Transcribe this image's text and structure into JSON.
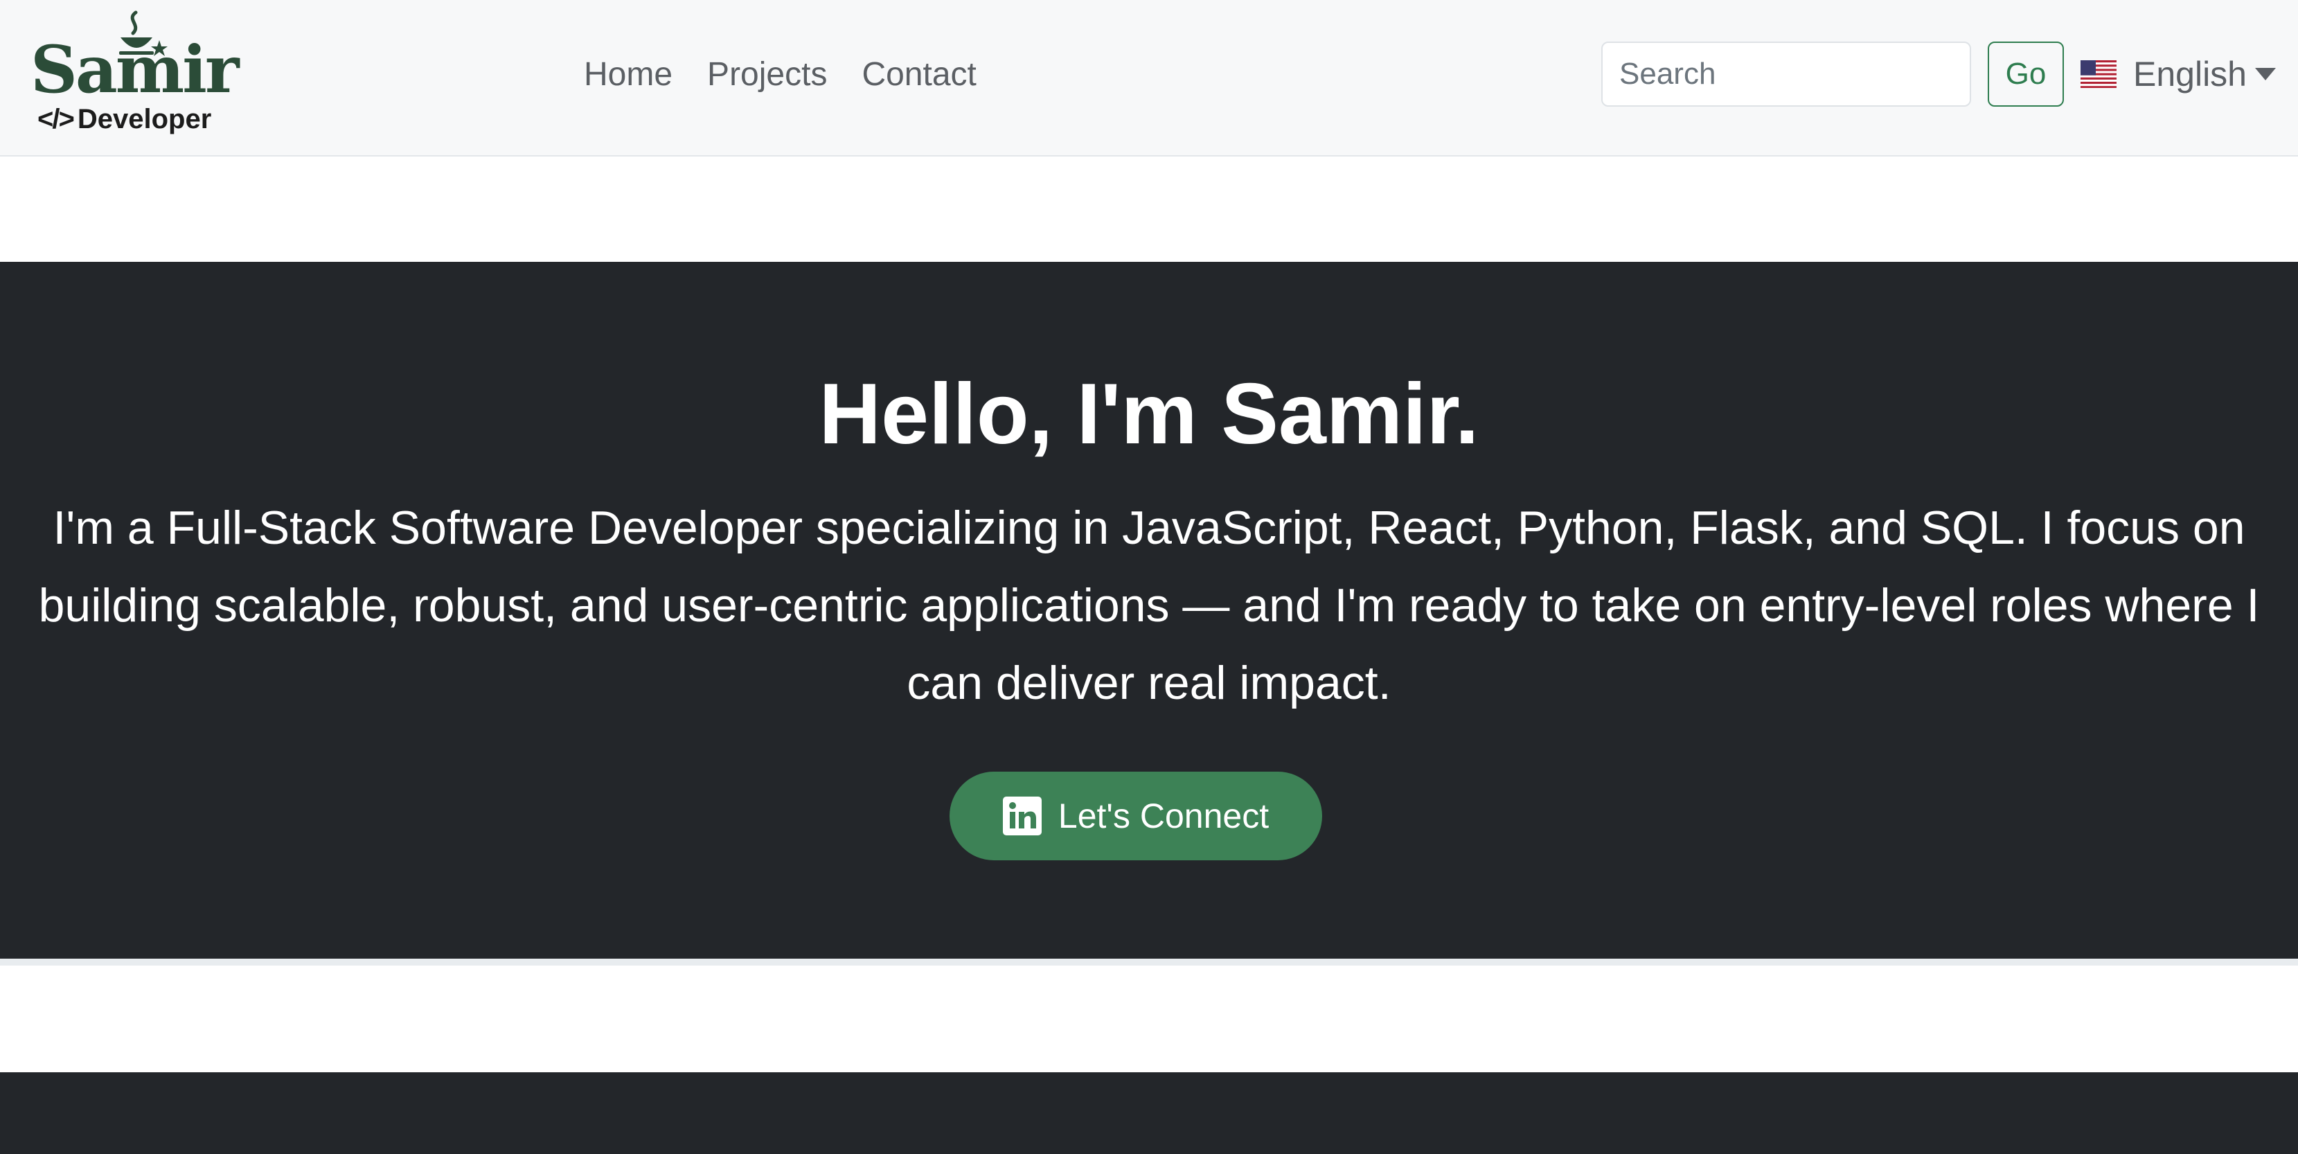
{
  "brand": {
    "name": "Samir",
    "code_glyph": "</>",
    "tagline": "Developer",
    "color": "#2b4c38"
  },
  "nav": {
    "links": [
      "Home",
      "Projects",
      "Contact"
    ]
  },
  "search": {
    "placeholder": "Search",
    "value": "",
    "button_label": "Go"
  },
  "language": {
    "label": "English",
    "flag_icon": "us-flag-icon"
  },
  "hero": {
    "title": "Hello, I'm Samir.",
    "description": "I'm a Full-Stack Software Developer specializing in JavaScript, React, Python, Flask, and SQL. I focus on building scalable, robust, and user-centric applications — and I'm ready to take on entry-level roles where I can deliver real impact.",
    "cta_label": "Let's Connect",
    "cta_icon": "linkedin-icon"
  },
  "colors": {
    "accent": "#3d8256",
    "dark": "#23262a",
    "navbar": "#f7f8f9"
  }
}
